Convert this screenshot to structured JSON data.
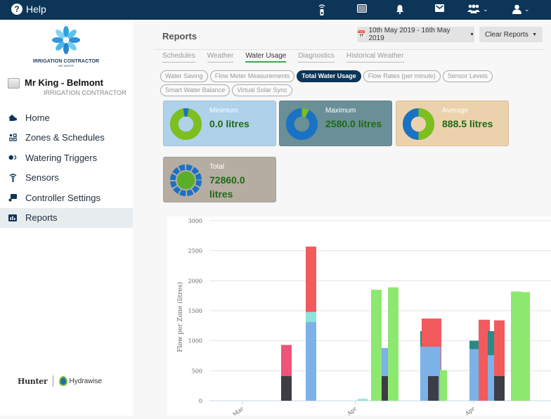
{
  "topbar": {
    "help_label": "Help",
    "icons": [
      "controller-remote-icon",
      "window-icon",
      "bell-icon",
      "mail-icon",
      "users-icon",
      "user-icon"
    ]
  },
  "sidebar": {
    "logo": {
      "brand": "IRRIGATION CONTRACTOR",
      "tagline": "WE WATER"
    },
    "account": {
      "name": "Mr King - Belmont",
      "subtitle": "IRRIGATION CONTRACTOR"
    },
    "nav": [
      {
        "label": "Home",
        "icon": "home-icon",
        "active": false
      },
      {
        "label": "Zones & Schedules",
        "icon": "zones-icon",
        "active": false
      },
      {
        "label": "Watering Triggers",
        "icon": "triggers-icon",
        "active": false
      },
      {
        "label": "Sensors",
        "icon": "sensor-icon",
        "active": false
      },
      {
        "label": "Controller Settings",
        "icon": "controller-icon",
        "active": false
      },
      {
        "label": "Reports",
        "icon": "chart-icon",
        "active": true
      }
    ],
    "partners": {
      "hunter": "Hunter",
      "hydrawise": "Hydrawise"
    }
  },
  "main": {
    "title": "Reports",
    "date_range": "10th May 2019 - 16th May 2019",
    "clear_label": "Clear Reports",
    "tabs": [
      {
        "label": "Schedules",
        "active": false
      },
      {
        "label": "Weather",
        "active": false
      },
      {
        "label": "Water Usage",
        "active": true
      },
      {
        "label": "Diagnostics",
        "active": false
      },
      {
        "label": "Historical Weather",
        "active": false
      }
    ],
    "pills": [
      {
        "label": "Water Saving",
        "active": false
      },
      {
        "label": "Flow Meter Measurements",
        "active": false
      },
      {
        "label": "Total Water Usage",
        "active": true
      },
      {
        "label": "Flow Rates (per minute)",
        "active": false
      },
      {
        "label": "Sensor Levels",
        "active": false
      },
      {
        "label": "Smart Water Balance",
        "active": false
      },
      {
        "label": "Virtual Solar Sync",
        "active": false
      }
    ],
    "cards": [
      {
        "label": "Minimum",
        "value": "0.0 litres",
        "bg": "#afd1ea",
        "donut": {
          "type": "ring",
          "fraction_blue": 0.05
        }
      },
      {
        "label": "Maximum",
        "value": "2580.0 litres",
        "bg": "#6b8f96",
        "donut": {
          "type": "ring",
          "fraction_green": 0.06
        }
      },
      {
        "label": "Average",
        "value": "888.5 litres",
        "bg": "#ebd2ad",
        "donut": {
          "type": "ring",
          "fraction_green": 0.5
        }
      },
      {
        "label": "Total",
        "value_line1": "72860.0",
        "value_line2": "litres",
        "bg": "#b6ada2",
        "donut": {
          "type": "segmented"
        }
      }
    ],
    "colors": {
      "navy": "#0d3557",
      "green_value": "#1d6b14",
      "donut_blue": "#1a72c4",
      "donut_green": "#7cbf1e"
    }
  },
  "chart_data": {
    "type": "bar",
    "stacked": "overlapping",
    "ylabel": "Flow per Zone (litres)",
    "ylim": [
      0,
      3000
    ],
    "yticks": [
      0,
      500,
      1000,
      1500,
      2000,
      2500,
      3000
    ],
    "xticks": [
      "Mar",
      "Apr",
      "Apr"
    ],
    "grid": true,
    "series_colors": {
      "red": "#f35a5e",
      "pink": "#ee5479",
      "dark": "#3d3d45",
      "blue": "#7db2e8",
      "teal": "#2a8a86",
      "cyan": "#8ee3dc",
      "green": "#8de870"
    },
    "groups": [
      {
        "bars": [
          {
            "color": "pink",
            "value": 930
          },
          {
            "color": "dark",
            "value": 410
          }
        ]
      },
      {
        "bars": [
          {
            "color": "red",
            "value": 2570
          },
          {
            "color": "cyan",
            "value": 1480
          },
          {
            "color": "blue",
            "value": 1310
          }
        ]
      },
      {
        "bars": [
          {
            "color": "cyan",
            "value": 30
          }
        ]
      },
      {
        "bars": [
          {
            "color": "green",
            "value": 1850
          }
        ]
      },
      {
        "bars": [
          {
            "color": "blue",
            "value": 880
          },
          {
            "color": "dark",
            "value": 410
          }
        ]
      },
      {
        "bars": [
          {
            "color": "green",
            "value": 1890
          }
        ]
      },
      {
        "bars": [
          {
            "color": "teal",
            "value": 1160
          },
          {
            "color": "blue",
            "value": 900
          }
        ]
      },
      {
        "bars": [
          {
            "color": "red",
            "value": 1370
          },
          {
            "color": "blue",
            "value": 900
          },
          {
            "color": "dark",
            "value": 410
          }
        ]
      },
      {
        "bars": [
          {
            "color": "green",
            "value": 510
          }
        ]
      },
      {
        "bars": [
          {
            "color": "teal",
            "value": 1000
          },
          {
            "color": "blue",
            "value": 860
          }
        ]
      },
      {
        "bars": [
          {
            "color": "red",
            "value": 1350
          }
        ]
      },
      {
        "bars": [
          {
            "color": "teal",
            "value": 1160
          },
          {
            "color": "blue",
            "value": 760
          }
        ]
      },
      {
        "bars": [
          {
            "color": "red",
            "value": 1340
          },
          {
            "color": "dark",
            "value": 410
          }
        ]
      },
      {
        "bars": [
          {
            "color": "green",
            "value": 1820
          }
        ]
      },
      {
        "bars": [
          {
            "color": "green",
            "value": 1810
          }
        ]
      }
    ]
  }
}
